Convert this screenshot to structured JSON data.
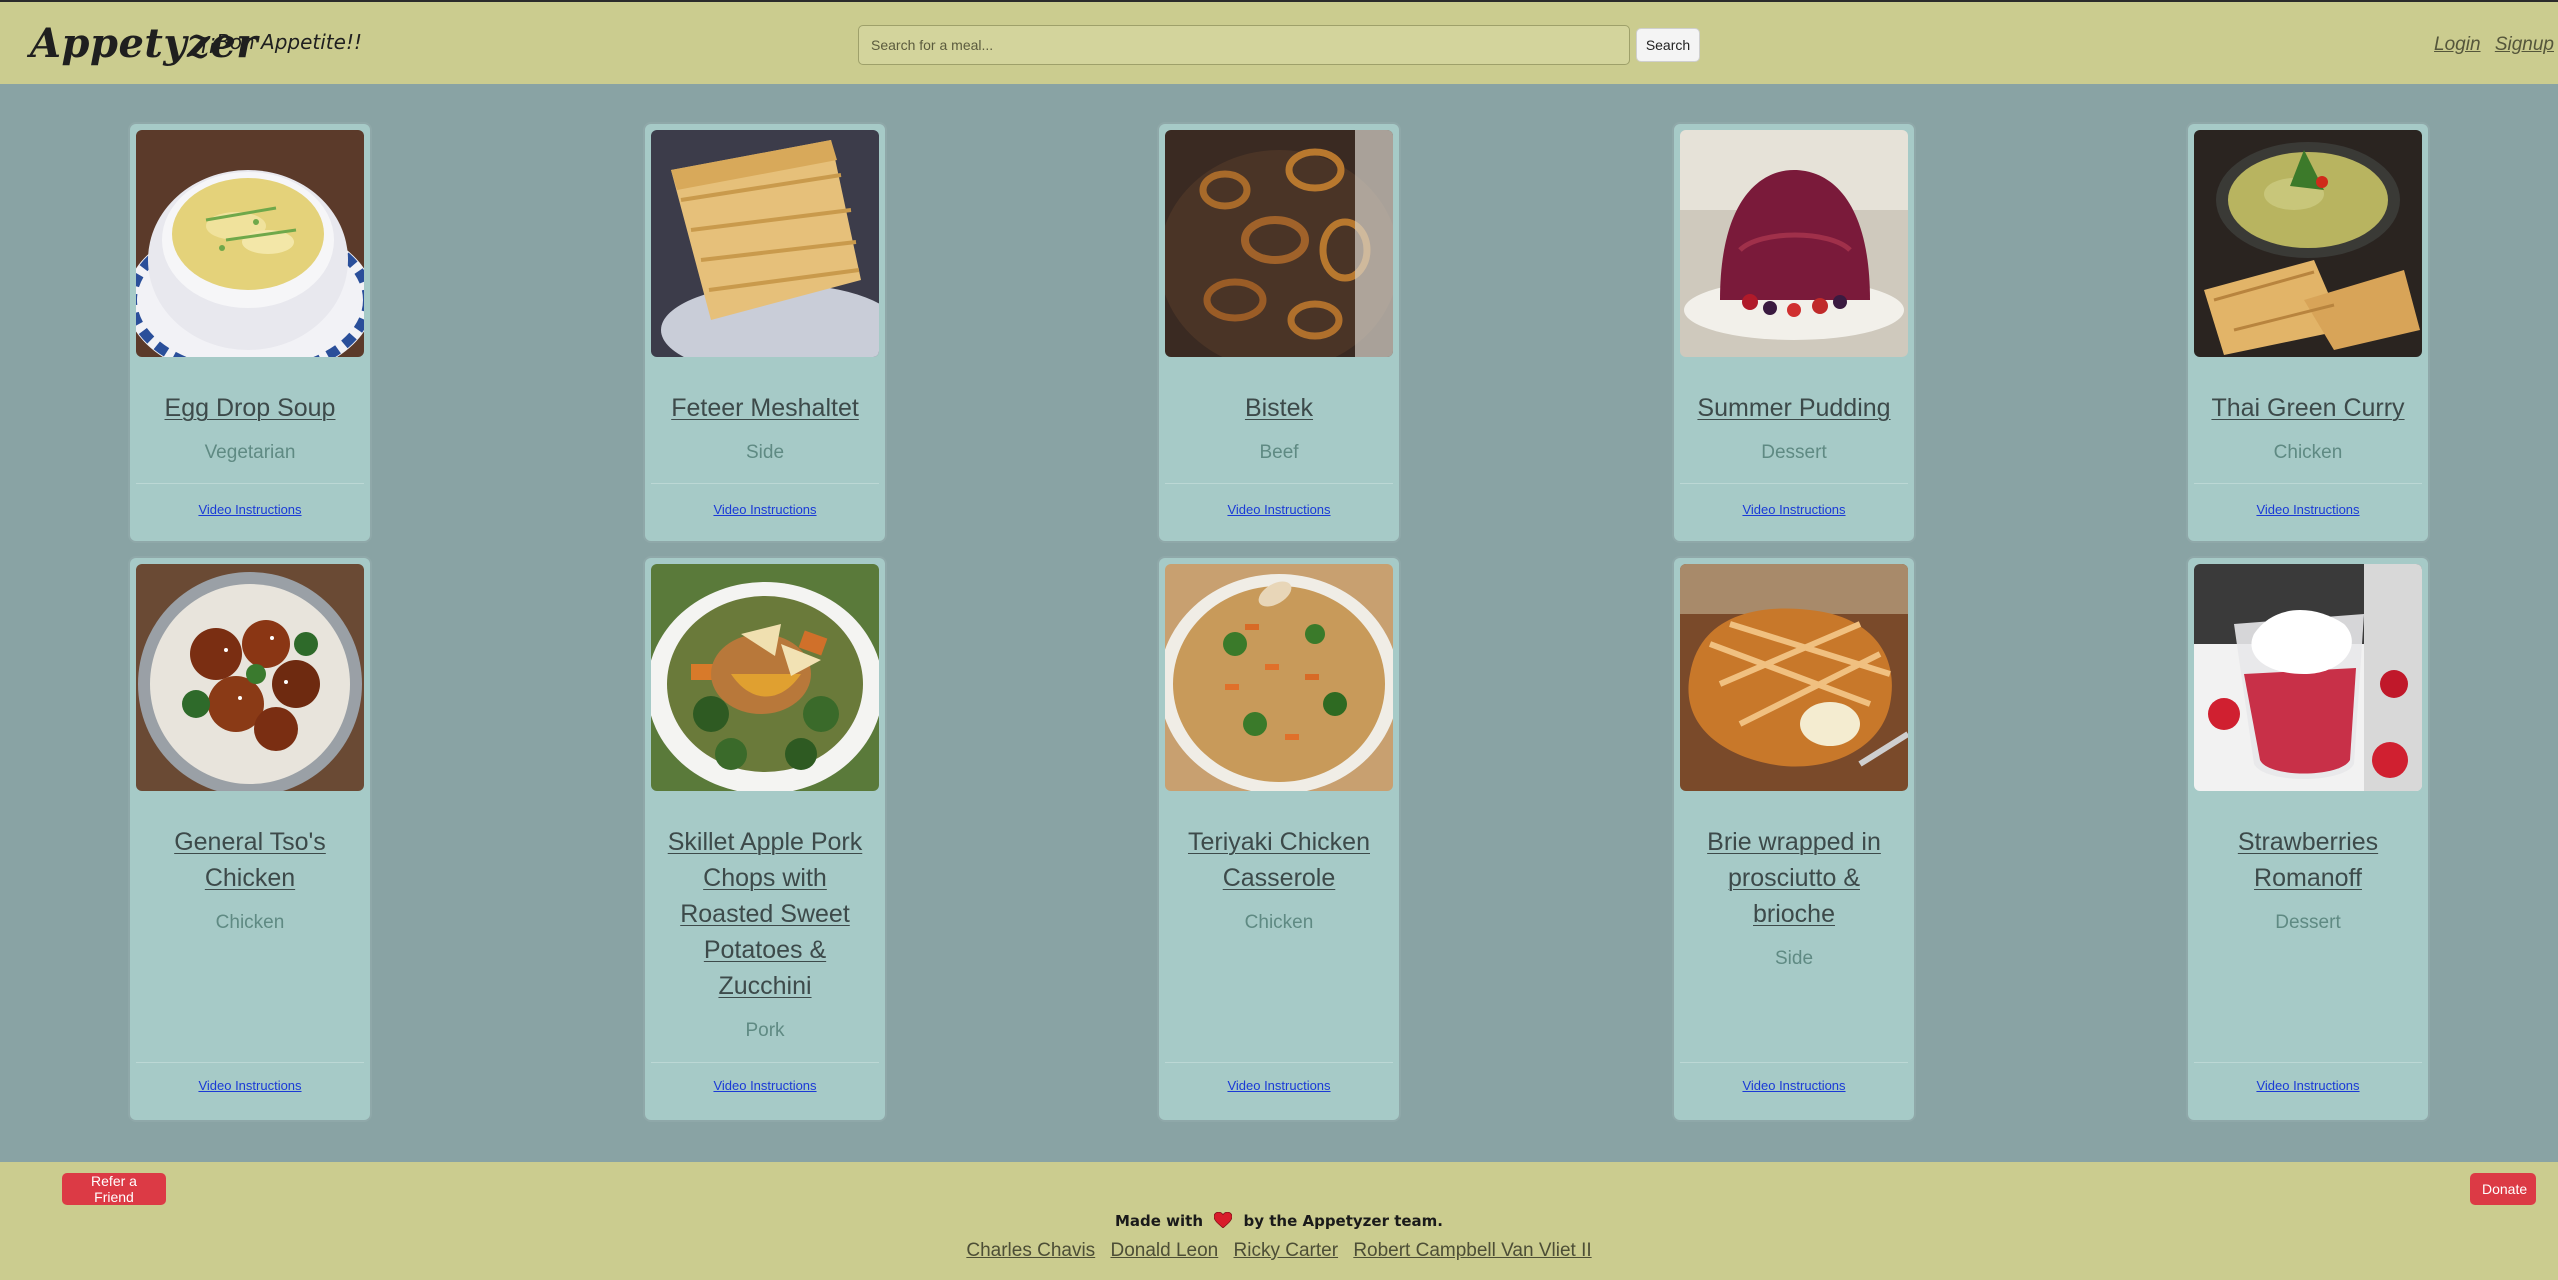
{
  "header": {
    "brand": "Appetyzer",
    "tagline": "¡¡Bon Appetite!!",
    "search_placeholder": "Search for a meal...",
    "search_button": "Search",
    "login": "Login",
    "signup": "Signup"
  },
  "cards": [
    {
      "title": "Egg Drop Soup",
      "category": "Vegetarian",
      "video": "Video Instructions",
      "image": "egg-drop-soup-photo"
    },
    {
      "title": "Feteer Meshaltet",
      "category": "Side",
      "video": "Video Instructions",
      "image": "feteer-meshaltet-photo"
    },
    {
      "title": "Bistek",
      "category": "Beef",
      "video": "Video Instructions",
      "image": "bistek-photo"
    },
    {
      "title": "Summer Pudding",
      "category": "Dessert",
      "video": "Video Instructions",
      "image": "summer-pudding-photo"
    },
    {
      "title": "Thai Green Curry",
      "category": "Chicken",
      "video": "Video Instructions",
      "image": "thai-green-curry-photo"
    },
    {
      "title": "General Tso's Chicken",
      "category": "Chicken",
      "video": "Video Instructions",
      "image": "general-tsos-chicken-photo"
    },
    {
      "title": "Skillet Apple Pork Chops with Roasted Sweet Potatoes & Zucchini",
      "category": "Pork",
      "video": "Video Instructions",
      "image": "skillet-pork-chops-photo"
    },
    {
      "title": "Teriyaki Chicken Casserole",
      "category": "Chicken",
      "video": "Video Instructions",
      "image": "teriyaki-casserole-photo"
    },
    {
      "title": "Brie wrapped in prosciutto & brioche",
      "category": "Side",
      "video": "Video Instructions",
      "image": "brie-brioche-photo"
    },
    {
      "title": "Strawberries Romanoff",
      "category": "Dessert",
      "video": "Video Instructions",
      "image": "strawberries-romanoff-photo"
    }
  ],
  "footer": {
    "refer_button": "Refer a Friend",
    "donate_button": "Donate",
    "made_with_prefix": "Made with",
    "made_with_suffix": "by the Appetyzer team.",
    "team": [
      "Charles Chavis",
      "Donald Leon",
      "Ricky Carter",
      "Robert Campbell Van Vliet II"
    ]
  },
  "colors": {
    "page_bg": "#89a3a4",
    "nav_bg": "#cbcc8f",
    "card_bg": "#a6cac7",
    "accent_red": "#dc3a45",
    "link_blue": "#1a3ad6"
  }
}
